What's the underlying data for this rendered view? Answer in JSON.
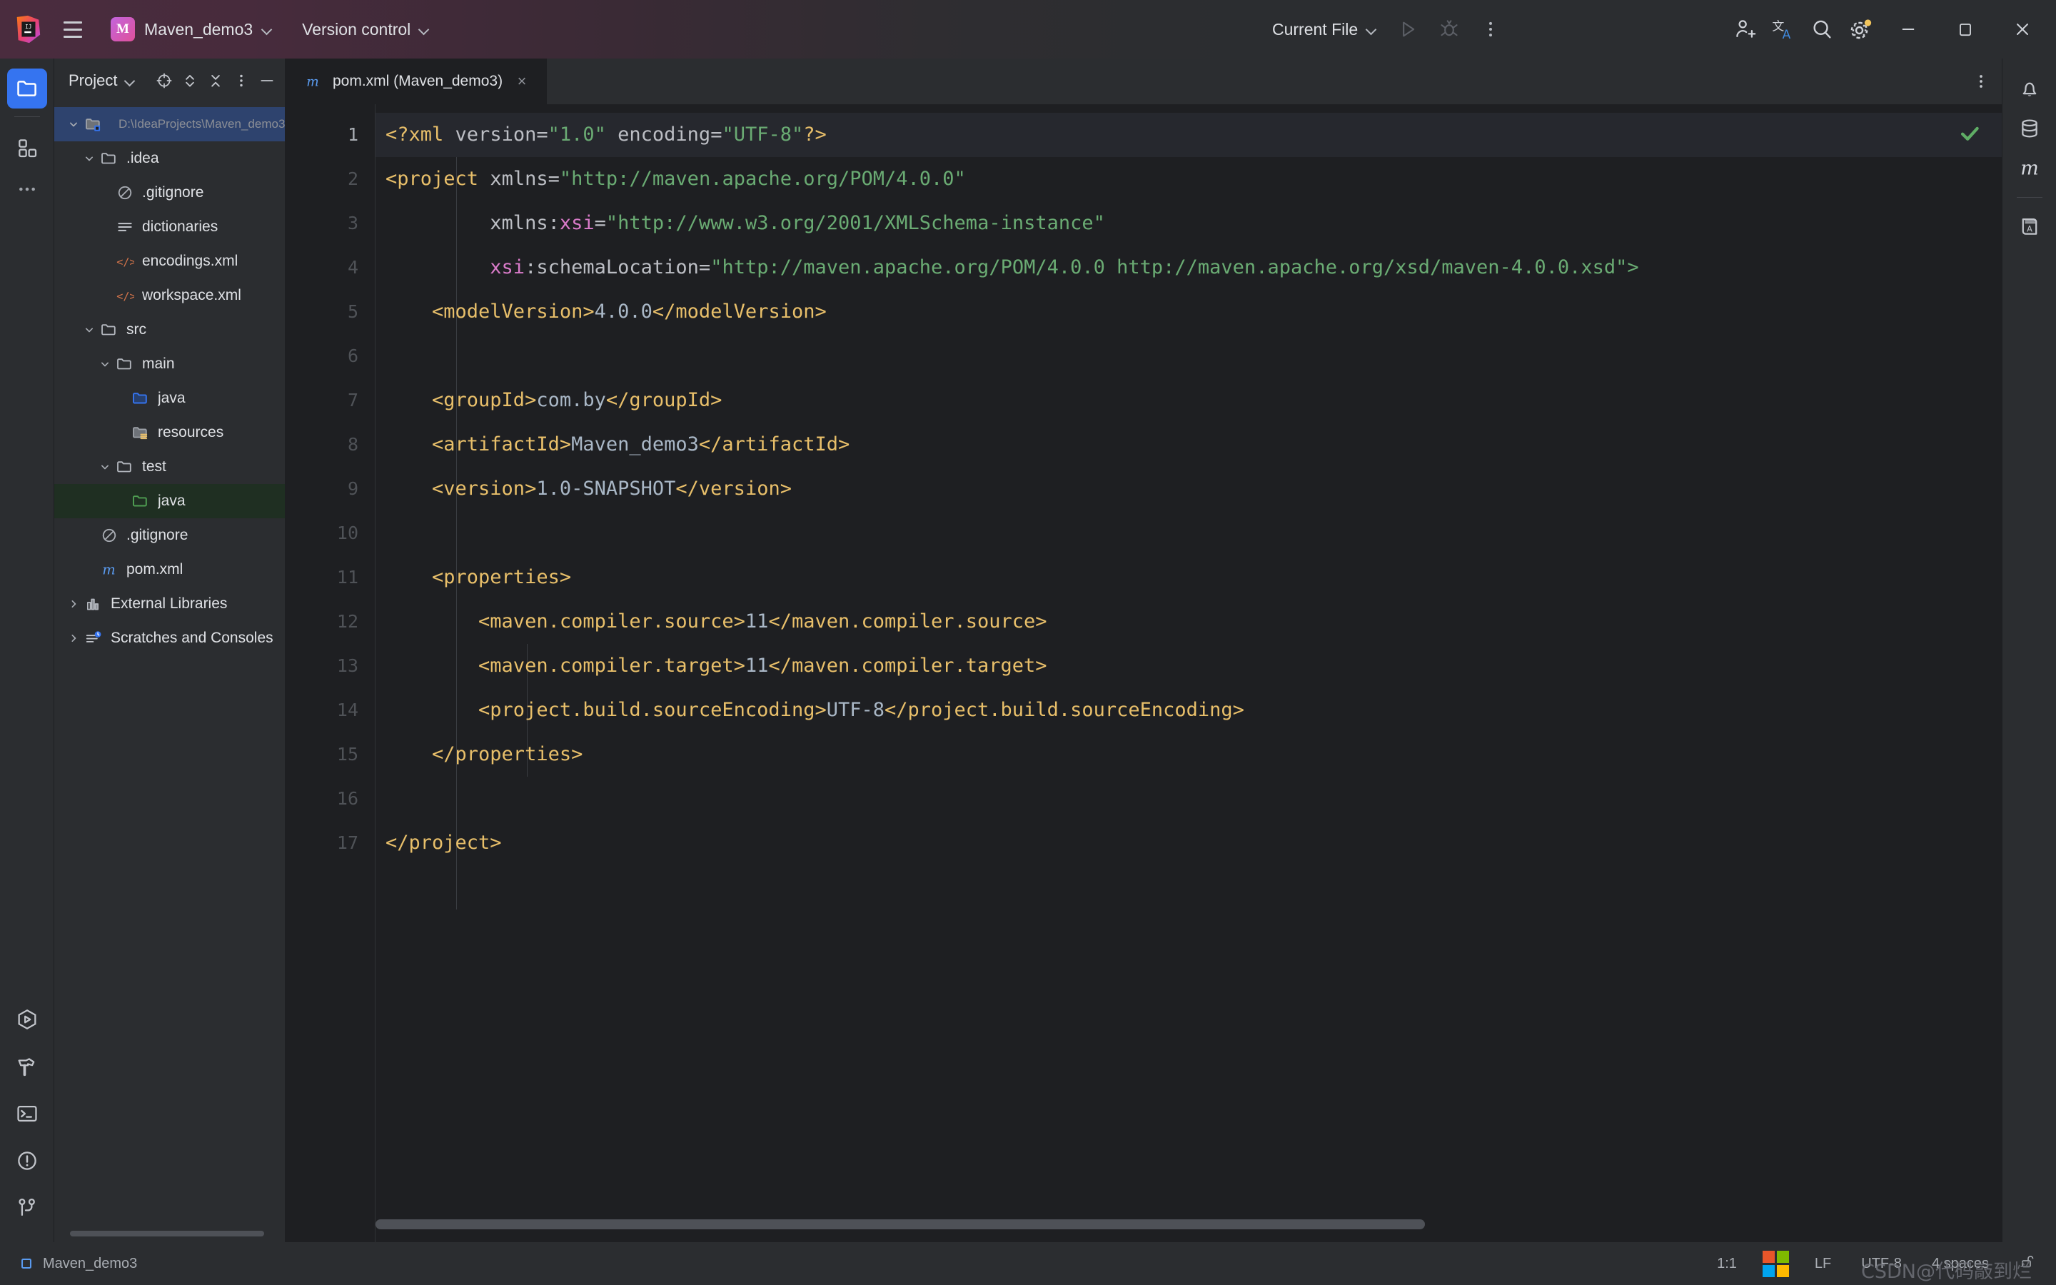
{
  "titlebar": {
    "project_name": "Maven_demo3",
    "project_badge": "M",
    "version_control": "Version control",
    "run_config": "Current File",
    "icons": {
      "menu": "hamburger-menu-icon",
      "run": "run-icon",
      "debug": "debug-icon",
      "more": "more-vertical-icon",
      "account": "add-account-icon",
      "translate": "translate-icon",
      "search": "search-icon",
      "settings": "settings-gear-icon",
      "minimize": "minimize-icon",
      "maximize": "maximize-icon",
      "close": "close-icon"
    }
  },
  "leftbar": {
    "items": [
      {
        "name": "project-tool-window",
        "icon": "folder-icon",
        "active": true
      },
      {
        "name": "structure-tool-window",
        "icon": "structure-blocks-icon",
        "active": false
      },
      {
        "name": "more-tool-windows",
        "icon": "ellipsis-icon",
        "active": false
      }
    ],
    "bottom_items": [
      {
        "name": "run-tool-window",
        "icon": "run-hexagon-icon"
      },
      {
        "name": "build-tool-window",
        "icon": "hammer-icon"
      },
      {
        "name": "terminal-tool-window",
        "icon": "terminal-icon"
      },
      {
        "name": "problems-tool-window",
        "icon": "warning-circle-icon"
      },
      {
        "name": "git-tool-window",
        "icon": "git-branch-icon"
      }
    ]
  },
  "rightbar": {
    "items": [
      {
        "name": "notifications-tool-window",
        "icon": "bell-icon"
      },
      {
        "name": "database-tool-window",
        "icon": "database-icon"
      },
      {
        "name": "maven-tool-window",
        "icon": "maven-m-icon"
      },
      {
        "name": "dictionary-tool-window",
        "icon": "book-a-icon"
      }
    ]
  },
  "project_panel": {
    "title": "Project",
    "tools": [
      {
        "name": "select-opened-file-button",
        "icon": "crosshair-target-icon"
      },
      {
        "name": "expand-all-button",
        "icon": "expand-chevrons-icon"
      },
      {
        "name": "collapse-all-button",
        "icon": "collapse-chevrons-icon"
      },
      {
        "name": "options-button",
        "icon": "more-vertical-icon"
      },
      {
        "name": "hide-button",
        "icon": "minus-icon"
      }
    ],
    "tree": [
      {
        "label": "Maven_demo3",
        "sub": "D:\\IdeaProjects\\Maven_demo3",
        "depth": 0,
        "arrow": "down",
        "icon": "project-folder-icon",
        "state": "selected",
        "bold": true
      },
      {
        "label": ".idea",
        "sub": "",
        "depth": 1,
        "arrow": "down",
        "icon": "folder-icon",
        "state": "",
        "bold": false
      },
      {
        "label": ".gitignore",
        "sub": "",
        "depth": 2,
        "arrow": "none",
        "icon": "gitignore-icon",
        "state": "",
        "bold": false
      },
      {
        "label": "dictionaries",
        "sub": "",
        "depth": 2,
        "arrow": "none",
        "icon": "list-lines-icon",
        "state": "",
        "bold": false
      },
      {
        "label": "encodings.xml",
        "sub": "",
        "depth": 2,
        "arrow": "none",
        "icon": "xml-file-icon",
        "state": "",
        "bold": false
      },
      {
        "label": "workspace.xml",
        "sub": "",
        "depth": 2,
        "arrow": "none",
        "icon": "xml-file-icon",
        "state": "",
        "bold": false
      },
      {
        "label": "src",
        "sub": "",
        "depth": 1,
        "arrow": "down",
        "icon": "folder-icon",
        "state": "",
        "bold": false
      },
      {
        "label": "main",
        "sub": "",
        "depth": 2,
        "arrow": "down",
        "icon": "folder-icon",
        "state": "",
        "bold": false
      },
      {
        "label": "java",
        "sub": "",
        "depth": 3,
        "arrow": "none",
        "icon": "source-root-folder-icon",
        "state": "",
        "bold": false
      },
      {
        "label": "resources",
        "sub": "",
        "depth": 3,
        "arrow": "none",
        "icon": "resources-folder-icon",
        "state": "",
        "bold": false
      },
      {
        "label": "test",
        "sub": "",
        "depth": 2,
        "arrow": "down",
        "icon": "folder-icon",
        "state": "",
        "bold": false
      },
      {
        "label": "java",
        "sub": "",
        "depth": 3,
        "arrow": "none",
        "icon": "test-source-root-folder-icon",
        "state": "testroot",
        "bold": false
      },
      {
        "label": ".gitignore",
        "sub": "",
        "depth": 1,
        "arrow": "none",
        "icon": "gitignore-icon",
        "state": "",
        "bold": false
      },
      {
        "label": "pom.xml",
        "sub": "",
        "depth": 1,
        "arrow": "none",
        "icon": "maven-m-icon",
        "state": "",
        "bold": false
      },
      {
        "label": "External Libraries",
        "sub": "",
        "depth": 0,
        "arrow": "right",
        "icon": "libraries-icon",
        "state": "",
        "bold": false
      },
      {
        "label": "Scratches and Consoles",
        "sub": "",
        "depth": 0,
        "arrow": "right",
        "icon": "scratches-icon",
        "state": "",
        "bold": false
      }
    ]
  },
  "editor": {
    "tab": {
      "label": "pom.xml (Maven_demo3)",
      "icon": "maven-m-icon",
      "close": "×"
    },
    "tab_options_icon": "more-vertical-icon",
    "inspection_status": "no-problems-check-icon",
    "lines": [
      {
        "n": "1",
        "current": true,
        "tokens": [
          {
            "t": "punct",
            "s": "<?xml "
          },
          {
            "t": "attr",
            "s": "version"
          },
          {
            "t": "eq",
            "s": "="
          },
          {
            "t": "val",
            "s": "\"1.0\""
          },
          {
            "t": "attr",
            "s": " encoding"
          },
          {
            "t": "eq",
            "s": "="
          },
          {
            "t": "val",
            "s": "\"UTF-8\""
          },
          {
            "t": "punct",
            "s": "?>"
          }
        ]
      },
      {
        "n": "2",
        "current": false,
        "tokens": [
          {
            "t": "punct",
            "s": "<"
          },
          {
            "t": "tag",
            "s": "project"
          },
          {
            "t": "attr",
            "s": " xmlns"
          },
          {
            "t": "eq",
            "s": "="
          },
          {
            "t": "val",
            "s": "\"http://maven.apache.org/POM/4.0.0\""
          }
        ]
      },
      {
        "n": "3",
        "current": false,
        "tokens": [
          {
            "t": "attr",
            "s": "         xmlns:"
          },
          {
            "t": "ns",
            "s": "xsi"
          },
          {
            "t": "eq",
            "s": "="
          },
          {
            "t": "val",
            "s": "\"http://www.w3.org/2001/XMLSchema-instance\""
          }
        ]
      },
      {
        "n": "4",
        "current": false,
        "tokens": [
          {
            "t": "ns",
            "s": "         xsi"
          },
          {
            "t": "attr",
            "s": ":schemaLocation"
          },
          {
            "t": "eq",
            "s": "="
          },
          {
            "t": "val",
            "s": "\"http://maven.apache.org/POM/4.0.0 http://maven.apache.org/xsd/maven-4.0.0.xsd\">"
          }
        ]
      },
      {
        "n": "5",
        "current": false,
        "tokens": [
          {
            "t": "tag",
            "s": "    <modelVersion>"
          },
          {
            "t": "text",
            "s": "4.0.0"
          },
          {
            "t": "tag",
            "s": "</modelVersion>"
          }
        ]
      },
      {
        "n": "6",
        "current": false,
        "tokens": []
      },
      {
        "n": "7",
        "current": false,
        "tokens": [
          {
            "t": "tag",
            "s": "    <groupId>"
          },
          {
            "t": "text",
            "s": "com.by"
          },
          {
            "t": "tag",
            "s": "</groupId>"
          }
        ]
      },
      {
        "n": "8",
        "current": false,
        "tokens": [
          {
            "t": "tag",
            "s": "    <artifactId>"
          },
          {
            "t": "text",
            "s": "Maven_demo3"
          },
          {
            "t": "tag",
            "s": "</artifactId>"
          }
        ]
      },
      {
        "n": "9",
        "current": false,
        "tokens": [
          {
            "t": "tag",
            "s": "    <version>"
          },
          {
            "t": "text",
            "s": "1.0-SNAPSHOT"
          },
          {
            "t": "tag",
            "s": "</version>"
          }
        ]
      },
      {
        "n": "10",
        "current": false,
        "tokens": []
      },
      {
        "n": "11",
        "current": false,
        "tokens": [
          {
            "t": "tag",
            "s": "    <properties>"
          }
        ]
      },
      {
        "n": "12",
        "current": false,
        "tokens": [
          {
            "t": "tag",
            "s": "        <maven.compiler.source>"
          },
          {
            "t": "text",
            "s": "11"
          },
          {
            "t": "tag",
            "s": "</maven.compiler.source>"
          }
        ]
      },
      {
        "n": "13",
        "current": false,
        "tokens": [
          {
            "t": "tag",
            "s": "        <maven.compiler.target>"
          },
          {
            "t": "text",
            "s": "11"
          },
          {
            "t": "tag",
            "s": "</maven.compiler.target>"
          }
        ]
      },
      {
        "n": "14",
        "current": false,
        "tokens": [
          {
            "t": "tag",
            "s": "        <project.build.sourceEncoding>"
          },
          {
            "t": "text",
            "s": "UTF-8"
          },
          {
            "t": "tag",
            "s": "</project.build.sourceEncoding>"
          }
        ]
      },
      {
        "n": "15",
        "current": false,
        "tokens": [
          {
            "t": "tag",
            "s": "    </properties>"
          }
        ]
      },
      {
        "n": "16",
        "current": false,
        "tokens": []
      },
      {
        "n": "17",
        "current": false,
        "tokens": [
          {
            "t": "tag",
            "s": "</project>"
          }
        ]
      }
    ]
  },
  "statusbar": {
    "project": "Maven_demo3",
    "project_icon": "module-square-icon",
    "caret": "1:1",
    "os_icon": "windows-logo-icon",
    "line_separator": "LF",
    "encoding": "UTF-8",
    "indent": "4 spaces",
    "lock_icon": "unlocked-padlock-icon",
    "watermark": "CSDN@代码敲到烂"
  },
  "colors": {
    "accent_blue": "#3574f0",
    "selection_blue": "#2e436e",
    "test_root_green": "#1f2f22",
    "tag_gold": "#e8bf6a",
    "string_green": "#6aab73",
    "ns_pink": "#d97bc9",
    "text_blue_grey": "#a9b7c6",
    "panel_bg": "#2b2d30",
    "editor_bg": "#1e1f22"
  }
}
